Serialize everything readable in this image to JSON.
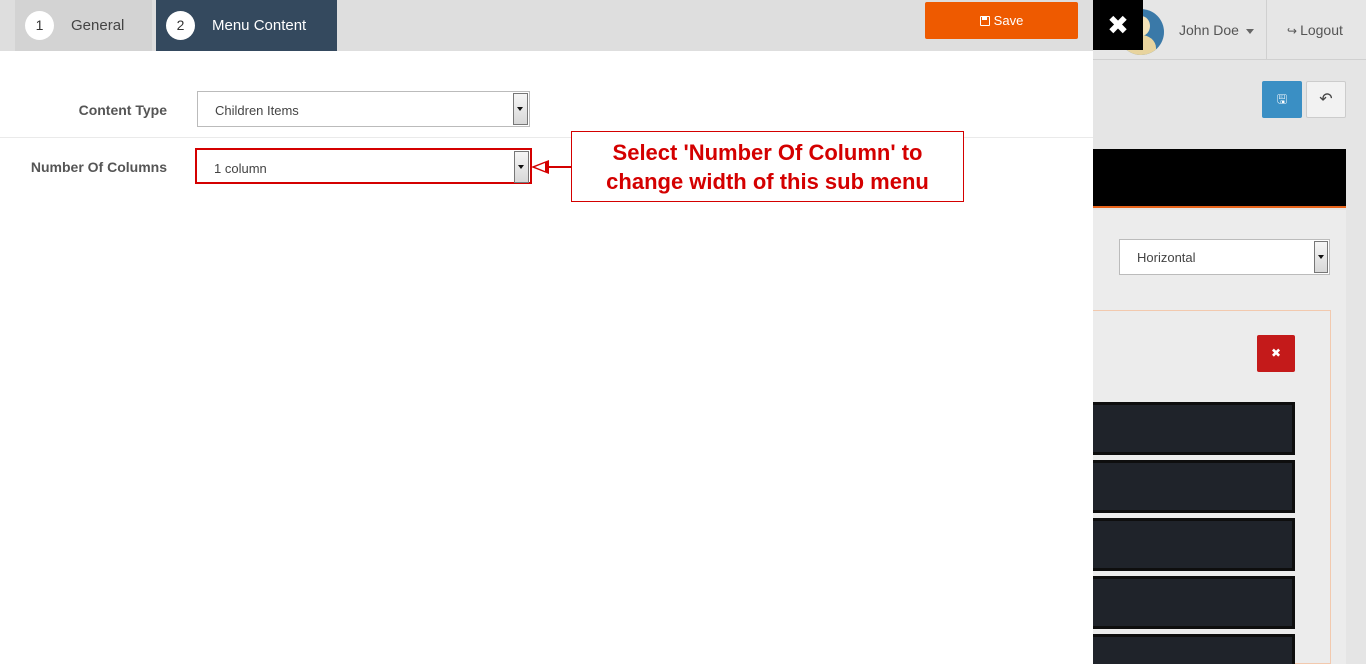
{
  "header": {
    "user_name": "John Doe",
    "logout_label": "Logout"
  },
  "modal": {
    "steps": [
      {
        "num": "1",
        "label": "General"
      },
      {
        "num": "2",
        "label": "Menu Content"
      }
    ],
    "save_label": "Save",
    "close_icon": "close-icon",
    "fields": {
      "content_type": {
        "label": "Content Type",
        "value": "Children Items"
      },
      "number_of_columns": {
        "label": "Number Of Columns",
        "value": "1 column"
      }
    },
    "annotation": {
      "line1": "Select 'Number Of Column' to",
      "line2": "change width of this sub menu"
    }
  },
  "background": {
    "orientation_value": "Horizontal"
  },
  "colors": {
    "accent_orange": "#ee5a00",
    "step_active": "#34495e",
    "annotation_red": "#d40000"
  }
}
